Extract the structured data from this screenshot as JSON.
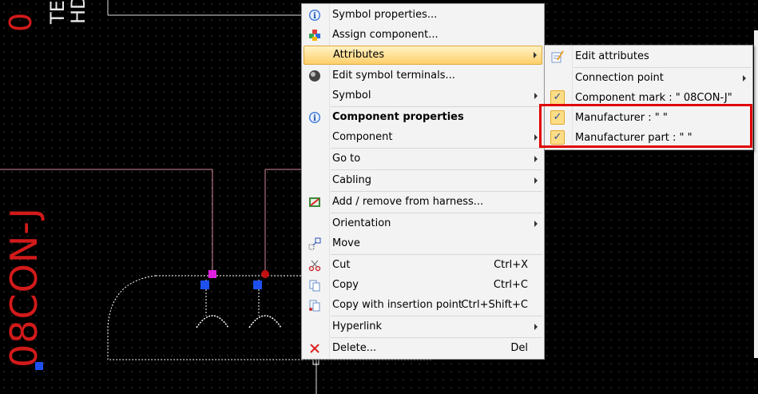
{
  "canvas": {
    "vertical_text_left": "08CON-J",
    "top_digit": "0",
    "top_text_1": "TE",
    "top_text_2": "HD"
  },
  "context_menu": {
    "items": [
      {
        "label": "Symbol properties...",
        "icon": "info-icon"
      },
      {
        "label": "Assign component...",
        "icon": "assign-component-icon"
      },
      {
        "label": "Attributes",
        "submenu": true,
        "highlighted": true
      },
      {
        "label": "Edit symbol terminals...",
        "icon": "terminal-icon"
      },
      {
        "label": "Symbol",
        "submenu": true
      },
      {
        "label": "Component properties",
        "icon": "info-icon",
        "bold": true
      },
      {
        "label": "Component",
        "submenu": true
      },
      {
        "label": "Go to",
        "submenu": true
      },
      {
        "label": "Cabling",
        "submenu": true
      },
      {
        "label": "Add / remove from harness...",
        "icon": "harness-icon"
      },
      {
        "label": "Orientation",
        "submenu": true
      },
      {
        "label": "Move",
        "icon": "move-icon"
      },
      {
        "label": "Cut",
        "shortcut": "Ctrl+X",
        "icon": "scissors-icon"
      },
      {
        "label": "Copy",
        "shortcut": "Ctrl+C",
        "icon": "copy-icon"
      },
      {
        "label": "Copy with insertion point",
        "shortcut": "Ctrl+Shift+C",
        "icon": "copy-insertion-icon"
      },
      {
        "label": "Hyperlink",
        "submenu": true
      },
      {
        "label": "Delete...",
        "shortcut": "Del",
        "icon": "delete-icon"
      }
    ]
  },
  "attributes_submenu": {
    "items": [
      {
        "label": "Edit attributes",
        "icon": "edit-attributes-icon"
      },
      {
        "label": "Connection point",
        "submenu": true
      },
      {
        "label": "Component mark : \" 08CON-J\"",
        "checked": true
      },
      {
        "label": "Manufacturer : \" \"",
        "checked": true
      },
      {
        "label": "Manufacturer part : \" \"",
        "checked": true
      }
    ]
  },
  "colors": {
    "highlight_box": "#e00000",
    "canvas_text": "#d21a1a",
    "wire": "#d4879a",
    "menu_highlight": "#ffcf6b"
  }
}
